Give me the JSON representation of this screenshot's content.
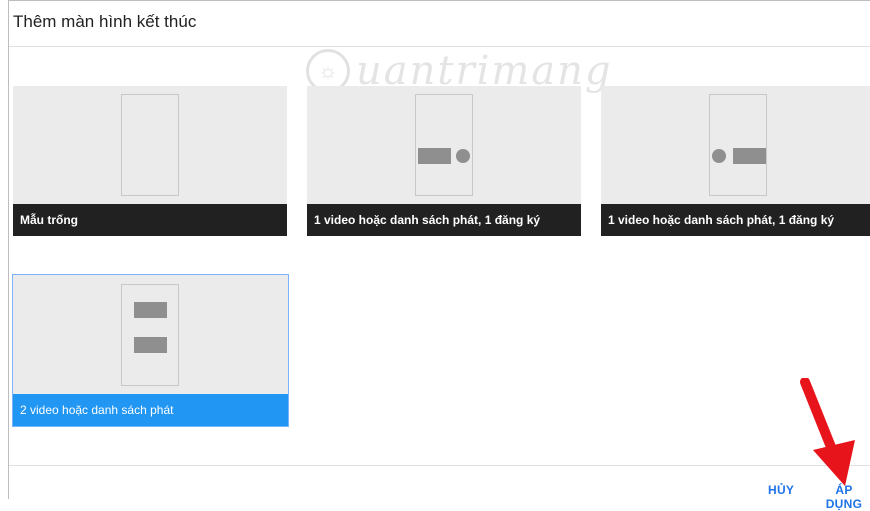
{
  "dialog": {
    "title": "Thêm màn hình kết thúc"
  },
  "watermark": {
    "text": "uantrimang",
    "icon": "bulb-q-logo"
  },
  "templates": [
    {
      "label": "Mẫu trống",
      "selected": false
    },
    {
      "label": "1 video hoặc danh sách phát, 1 đăng ký",
      "selected": false
    },
    {
      "label": "1 video hoặc danh sách phát, 1 đăng ký",
      "selected": false
    },
    {
      "label": "2 video hoặc danh sách phát",
      "selected": true
    }
  ],
  "footer": {
    "cancel_label": "HỦY",
    "apply_label": "ÁP DỤNG"
  },
  "colors": {
    "accent": "#2196f3",
    "link": "#1e73e8",
    "label_bg": "#212121",
    "card_bg": "#ebebeb",
    "annotation_arrow": "#e8141b"
  }
}
